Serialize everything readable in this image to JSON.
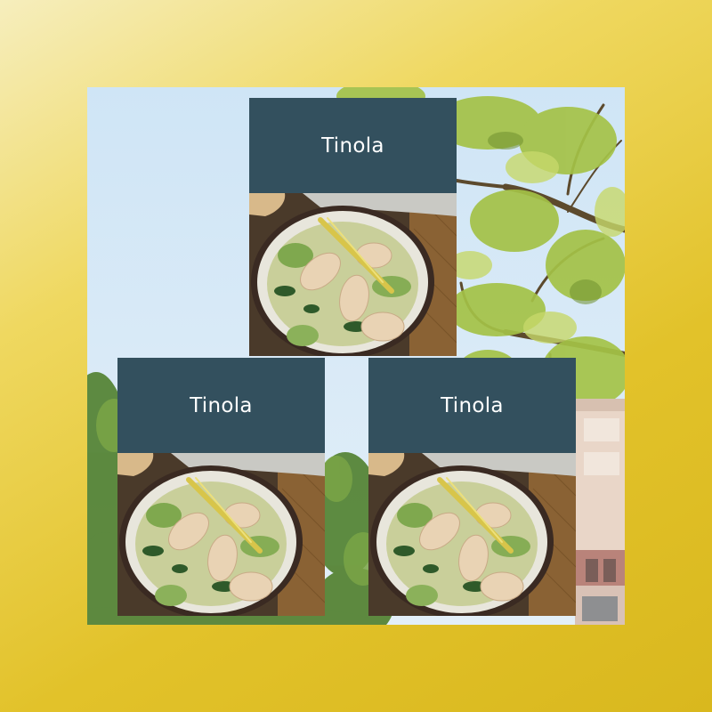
{
  "cards": [
    {
      "title": "Tinola"
    },
    {
      "title": "Tinola"
    },
    {
      "title": "Tinola"
    }
  ],
  "colors": {
    "background_gradient_light": "#f6eebd",
    "background_gradient_dark": "#d9b81e",
    "sky": "#d6e9f6",
    "foliage": "#9dbb42",
    "card_header": "#33505e",
    "card_title": "#ffffff"
  },
  "icons": [
    "tree-illustration",
    "building-illustration",
    "tinola-soup-photo"
  ]
}
